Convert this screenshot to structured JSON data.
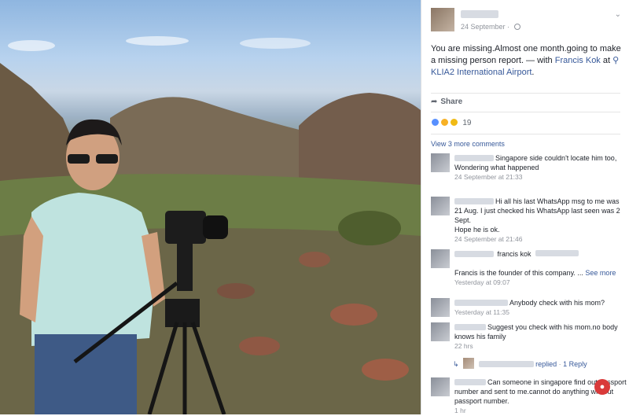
{
  "post": {
    "date": "24 September · ",
    "text_main": "You are missing.Almost one month.going to make a missing person report. — with ",
    "tagged_person": "Francis Kok",
    "text_at": " at ",
    "location": "KLIA2 International Airport",
    "text_end": "."
  },
  "actions": {
    "share_label": "Share"
  },
  "reactions": {
    "count": "19"
  },
  "comments_section": {
    "view_more": "View 3 more comments",
    "comments": [
      {
        "text": "Singapore side couldn't locate him too,",
        "text2": "Wondering what happened",
        "meta": "24 September at 21:33"
      },
      {
        "text": "Hi all his last WhatsApp msg to me was 21 Aug. I just checked his WhatsApp last seen was 2 Sept.",
        "text2": "Hope he is ok.",
        "meta": "24 September at 21:46"
      },
      {
        "text": "francis kok",
        "text2": "Francis is the founder of this company. ... ",
        "see_more": "See more",
        "meta": "Yesterday at 09:07"
      },
      {
        "text": "Anybody check with his mom?",
        "meta": "Yesterday at 11:35"
      },
      {
        "text": "Suggest you check with his mom.no body knows his family",
        "meta": "22 hrs"
      },
      {
        "text": "Can someone in singapore find out passport number and sent to me.cannot do anything without passport number.",
        "meta": "1 hr"
      }
    ],
    "reply": {
      "replied": "replied",
      "separator": " · ",
      "count": "1 Reply"
    }
  },
  "icons": {
    "globe": "globe-icon",
    "pin": "location-pin-icon",
    "share": "share-arrow-icon",
    "chevron": "chevron-down-icon",
    "reply": "reply-arrow-icon"
  },
  "colors": {
    "link": "#365899",
    "meta": "#90949c",
    "text": "#1d2129",
    "like": "#5890ff"
  }
}
